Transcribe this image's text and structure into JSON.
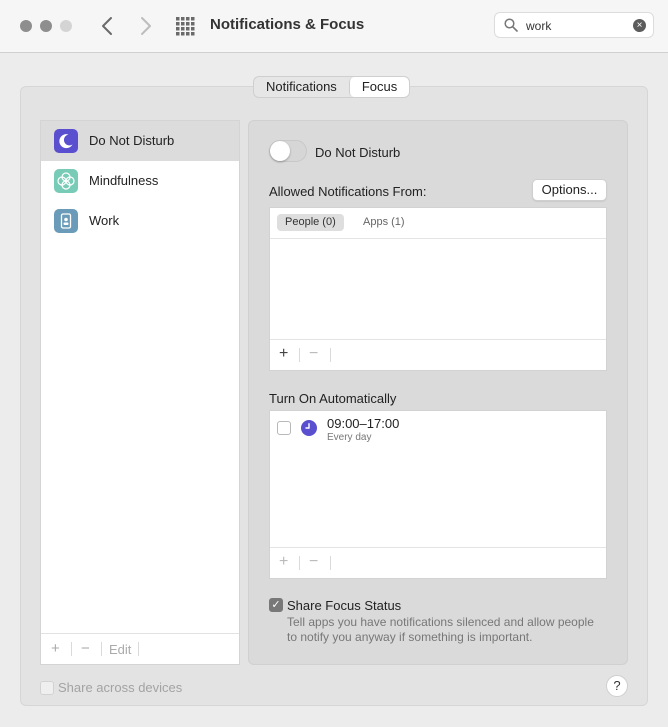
{
  "window": {
    "title": "Notifications & Focus",
    "search": {
      "value": "work",
      "placeholder": "Search"
    }
  },
  "tabs": [
    {
      "label": "Notifications",
      "active": false
    },
    {
      "label": "Focus",
      "active": true
    }
  ],
  "focus_list": {
    "items": [
      {
        "label": "Do Not Disturb",
        "icon": "moon-icon",
        "selected": true,
        "color": "#5a4fcf"
      },
      {
        "label": "Mindfulness",
        "icon": "flower-icon",
        "selected": false,
        "color": "#78cbb6"
      },
      {
        "label": "Work",
        "icon": "badge-icon",
        "selected": false,
        "color": "#6a9bb8"
      }
    ],
    "footer": {
      "add": "+",
      "remove": "−",
      "edit": "Edit"
    }
  },
  "detail": {
    "toggle_label": "Do Not Disturb",
    "toggle_on": false,
    "allowed_label": "Allowed Notifications From:",
    "options_button": "Options...",
    "allowed_tabs": [
      {
        "label": "People (0)",
        "active": true
      },
      {
        "label": "Apps (1)",
        "active": false
      }
    ],
    "allowed_footer": {
      "add": "+",
      "remove": "−"
    },
    "auto_label": "Turn On Automatically",
    "schedules": [
      {
        "time": "09:00–17:00",
        "days": "Every day",
        "enabled": false
      }
    ],
    "auto_footer": {
      "add": "+",
      "remove": "−"
    },
    "share_status": {
      "label": "Share Focus Status",
      "checked": true,
      "description": "Tell apps you have notifications silenced and allow people to notify you anyway if something is important."
    }
  },
  "bottom": {
    "share_across_label": "Share across devices",
    "share_across_checked": false,
    "help_label": "?"
  }
}
